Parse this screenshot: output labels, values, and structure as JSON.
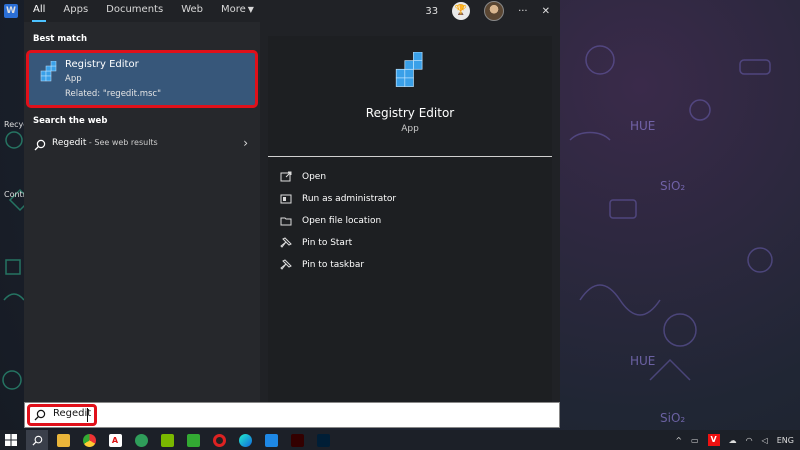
{
  "tabs": [
    {
      "label": "All",
      "active": true
    },
    {
      "label": "Apps"
    },
    {
      "label": "Documents"
    },
    {
      "label": "Web"
    },
    {
      "label": "More"
    }
  ],
  "header": {
    "points": "33",
    "more_label": "···",
    "close_label": "✕"
  },
  "best_match": {
    "section_label": "Best match",
    "title": "Registry Editor",
    "type": "App",
    "related": "Related: \"regedit.msc\""
  },
  "web_search": {
    "section_label": "Search the web",
    "query": "Regedit",
    "suffix": " - See web results"
  },
  "detail": {
    "title": "Registry Editor",
    "type": "App",
    "actions": [
      {
        "label": "Open",
        "icon": "open-icon"
      },
      {
        "label": "Run as administrator",
        "icon": "shield-icon"
      },
      {
        "label": "Open file location",
        "icon": "folder-icon"
      },
      {
        "label": "Pin to Start",
        "icon": "pin-icon"
      },
      {
        "label": "Pin to taskbar",
        "icon": "pin-icon"
      }
    ]
  },
  "search": {
    "value": "Regedit"
  },
  "tray": {
    "v_label": "V",
    "lang": "ENG"
  },
  "desktop": {
    "icon_label_1": "Recyc",
    "icon_label_2": "Contro",
    "word_label": "W"
  },
  "colors": {
    "accent": "#4cc2ff",
    "highlight": "#e0101a",
    "selected_bg": "#37577a"
  }
}
